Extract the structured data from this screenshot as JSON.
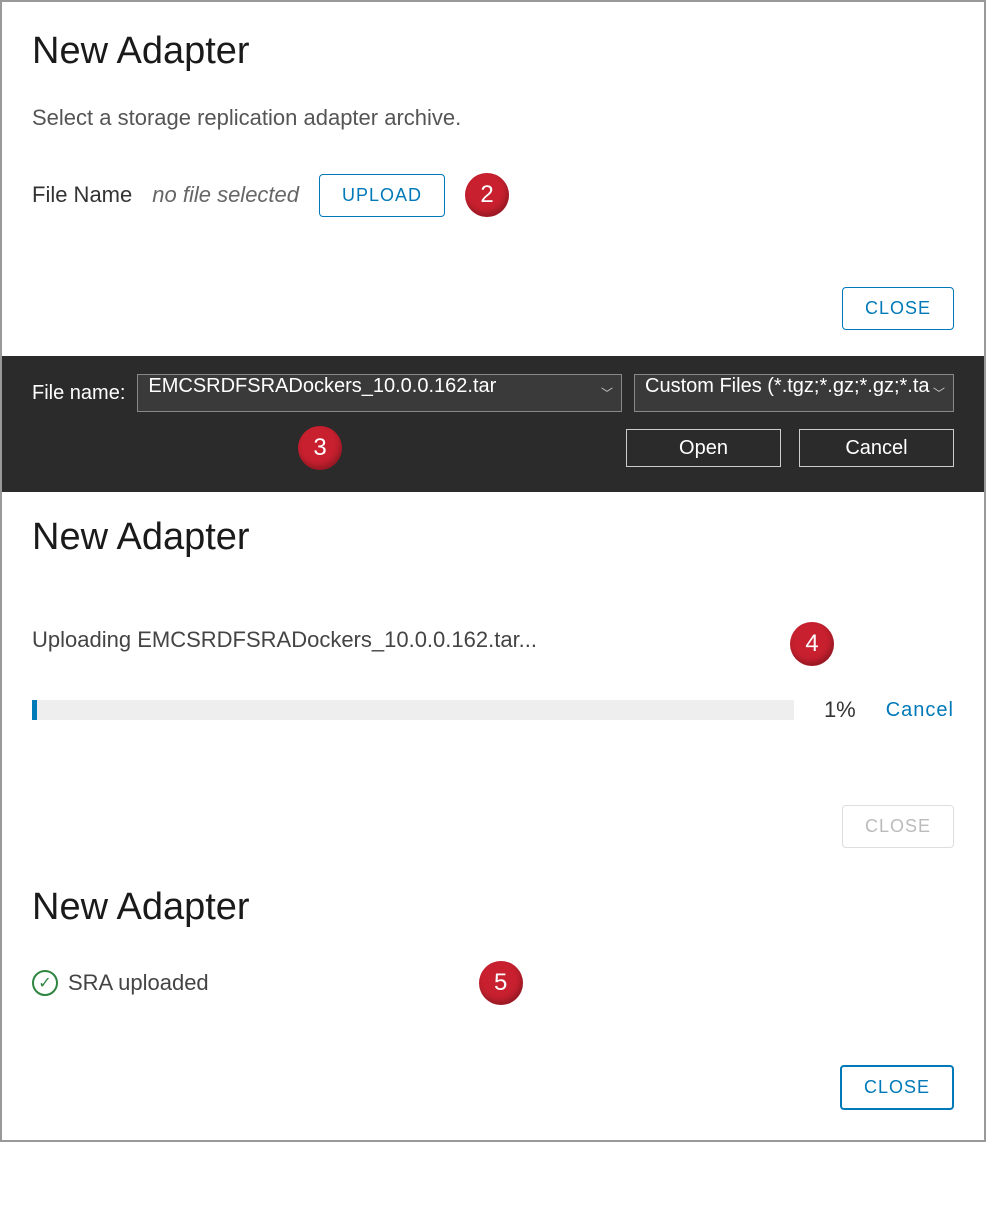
{
  "panel1": {
    "title": "New Adapter",
    "subtitle": "Select a storage replication adapter archive.",
    "file_label": "File Name",
    "no_file": "no file selected",
    "upload_btn": "Upload",
    "close_btn": "Close",
    "step": "2"
  },
  "picker": {
    "label": "File name:",
    "value": "EMCSRDFSRADockers_10.0.0.162.tar",
    "filter": "Custom Files (*.tgz;*.gz;*.gz;*.ta",
    "open": "Open",
    "cancel": "Cancel",
    "step": "3"
  },
  "panel2": {
    "title": "New Adapter",
    "uploading_text": "Uploading EMCSRDFSRADockers_10.0.0.162.tar...",
    "percent": "1%",
    "cancel": "Cancel",
    "close": "Close",
    "step": "4"
  },
  "panel3": {
    "title": "New Adapter",
    "done_text": "SRA uploaded",
    "close": "Close",
    "step": "5"
  }
}
